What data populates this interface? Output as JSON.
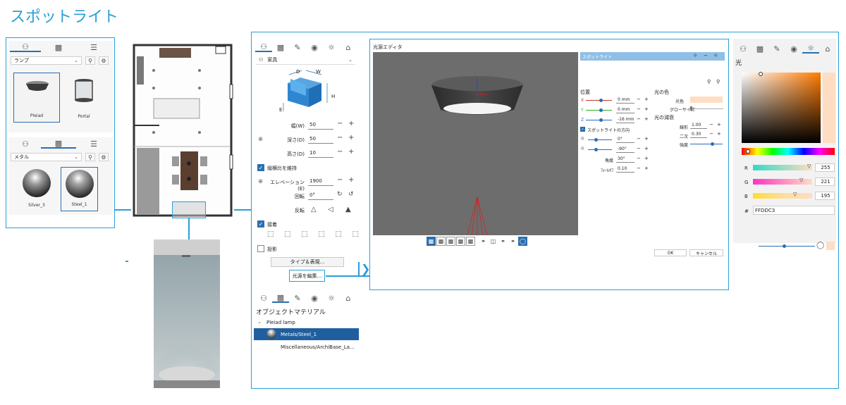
{
  "title": "スポットライト",
  "library": {
    "tabs": [
      "furniture-icon",
      "materials-icon",
      "list-icon"
    ],
    "category": "ランプ",
    "items": [
      {
        "label": "Pleiad",
        "selected": true
      },
      {
        "label": "Portal",
        "selected": false
      }
    ],
    "materials_category": "メタル",
    "materials": [
      {
        "label": "Silver_3",
        "selected": false
      },
      {
        "label": "Steel_1",
        "selected": true
      }
    ]
  },
  "props": {
    "category": "家具",
    "dim_labels": {
      "d": "D",
      "w": "W",
      "h": "H",
      "e": "E"
    },
    "width_label": "幅(W)",
    "width_value": "50",
    "depth_label": "深さ(D)",
    "depth_value": "50",
    "height_label": "高さ(D)",
    "height_value": "10",
    "keep_ratio_label": "縦横比を維持",
    "elevation_label": "エレベーション(E)",
    "elevation_value": "1900",
    "rotation_label": "回転",
    "rotation_value": "0°",
    "flip_label": "反転",
    "snap_label": "接着",
    "shadow_label": "投影",
    "type_button": "タイプ＆表現...",
    "edit_light_button": "光源を編集..."
  },
  "materials_panel": {
    "title": "オブジェクトマテリアル",
    "group": "Pleiad lamp",
    "items": [
      {
        "label": "Metals/Steel_1",
        "selected": true
      },
      {
        "label": "Miscellaneous/ArchiBase_La...",
        "selected": false
      }
    ]
  },
  "light_editor": {
    "title": "光源エディタ",
    "light_name": "スポットライト",
    "position_label": "位置",
    "x_label": "X",
    "x_value": "0 mm",
    "y_label": "Y",
    "y_value": "0 mm",
    "z_label": "Z",
    "z_value": "-16 mm",
    "spot_dir_label": "スポットライトの方向",
    "dir_a_value": "0°",
    "dir_b_value": "-90°",
    "angle_label": "角度",
    "angle_value": "30°",
    "falloff_label": "ﾌｫｰﾙｵﾌ",
    "falloff_value": "0.10",
    "color_section": "光の色",
    "color_label": "光色",
    "glow_label": "グローサイズ",
    "decay_section": "光の減衰",
    "linear_label": "線形",
    "linear_value": "1.00",
    "quad_label": "二次",
    "quad_value": "0.30",
    "intensity_label": "強度",
    "ok": "OK",
    "cancel": "キャンセル"
  },
  "color_panel": {
    "title": "光",
    "r_label": "R",
    "r_value": "255",
    "g_label": "G",
    "g_value": "221",
    "b_label": "B",
    "b_value": "195",
    "hash_label": "#",
    "hex_value": "FFDDC3",
    "swatch": "#FFDDC3"
  },
  "colors": {
    "accent": "#2a9fd6",
    "selection": "#1f5f9e"
  }
}
